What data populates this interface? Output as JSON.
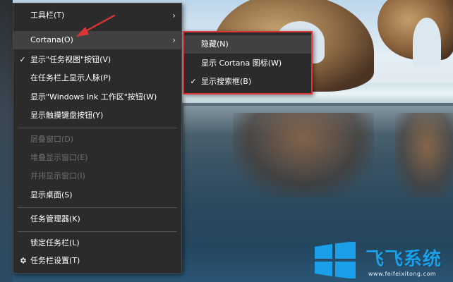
{
  "context_menu": {
    "items": [
      {
        "label": "工具栏(T)",
        "has_submenu": true
      },
      {
        "label": "Cortana(O)",
        "has_submenu": true,
        "highlighted": true
      },
      {
        "label": "显示\"任务视图\"按钮(V)",
        "checked": true
      },
      {
        "label": "在任务栏上显示人脉(P)"
      },
      {
        "label": "显示\"Windows Ink 工作区\"按钮(W)"
      },
      {
        "label": "显示触摸键盘按钮(Y)"
      },
      {
        "label": "层叠窗口(D)",
        "disabled": true
      },
      {
        "label": "堆叠显示窗口(E)",
        "disabled": true
      },
      {
        "label": "并排显示窗口(I)",
        "disabled": true
      },
      {
        "label": "显示桌面(S)"
      },
      {
        "label": "任务管理器(K)"
      },
      {
        "label": "锁定任务栏(L)"
      },
      {
        "label": "任务栏设置(T)",
        "icon": "gear-icon"
      }
    ],
    "check_glyph": "✓",
    "arrow_glyph": "›"
  },
  "cortana_submenu": {
    "items": [
      {
        "label": "隐藏(N)",
        "highlighted": true
      },
      {
        "label": "显示 Cortana 图标(W)"
      },
      {
        "label": "显示搜索框(B)",
        "checked": true
      }
    ],
    "border_color": "#e03434"
  },
  "watermark": {
    "brand": "飞飞系统",
    "url": "www.feifeixitong.com"
  },
  "colors": {
    "menu_bg": "#2b2b2b",
    "hover_bg": "#414141",
    "disabled_text": "#6d6d6d",
    "annotation_red": "#e03434",
    "brand_blue": "#1aa0e8"
  }
}
